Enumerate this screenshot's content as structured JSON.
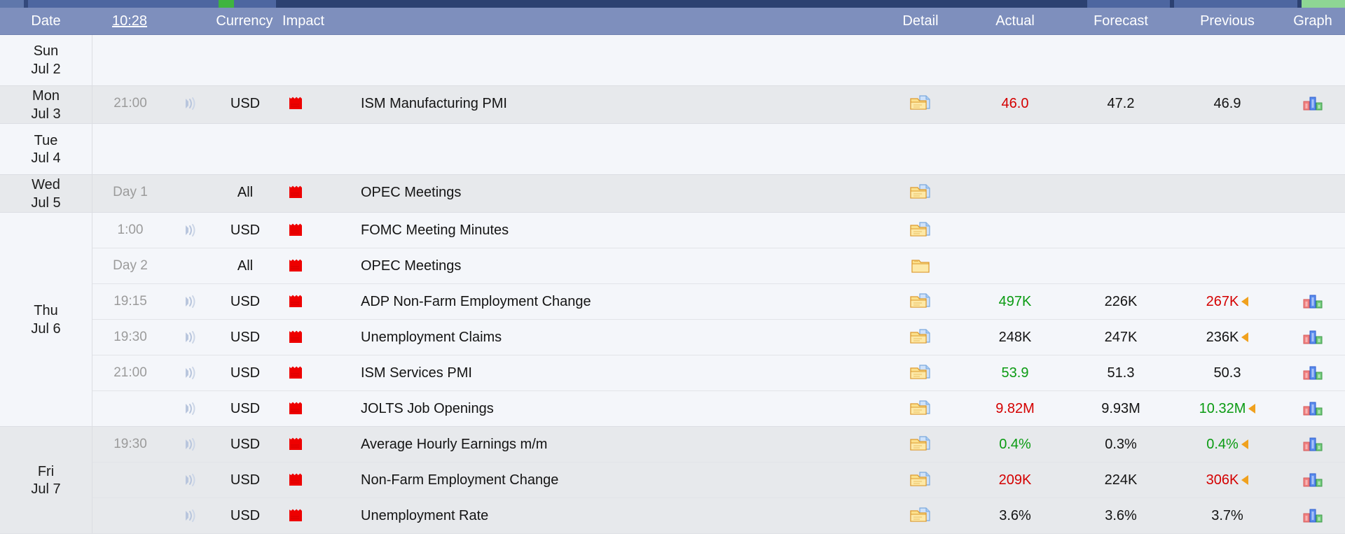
{
  "header": {
    "columns": {
      "date": "Date",
      "time": "10:28",
      "currency": "Currency",
      "impact": "Impact",
      "detail": "Detail",
      "actual": "Actual",
      "forecast": "Forecast",
      "previous": "Previous",
      "graph": "Graph"
    },
    "accent_bg": "#7e8fbd",
    "accent_text": "#ffffff",
    "topbar_bg": "#33497c",
    "topbar_highlight": "#3fb43f"
  },
  "icons": {
    "sound": "sound-icon",
    "impact": "red-folded-flag-icon",
    "detail": "folder-document-icon",
    "detail_plain": "folder-icon",
    "graph": "bar-chart-icon",
    "revision": "revision-triangle-icon"
  },
  "colors": {
    "value_worse": "#d40000",
    "value_better": "#0a9b12",
    "value_neutral": "#141414",
    "revision": "#f0a11e",
    "row_light": "#f4f6fa",
    "row_dark": "#e7e9ec"
  },
  "days": [
    {
      "weekday": "Sun",
      "date": "Jul 2",
      "band": "light",
      "events": []
    },
    {
      "weekday": "Mon",
      "date": "Jul 3",
      "band": "dark",
      "events": [
        {
          "time": "21:00",
          "sound": true,
          "currency": "USD",
          "impact": "high",
          "event": "ISM Manufacturing PMI",
          "detail": "folder-document",
          "actual": "46.0",
          "actual_tone": "red",
          "forecast": "47.2",
          "previous": "46.9",
          "previous_tone": "black",
          "previous_revised": false,
          "graph": true
        }
      ]
    },
    {
      "weekday": "Tue",
      "date": "Jul 4",
      "band": "light",
      "events": []
    },
    {
      "weekday": "Wed",
      "date": "Jul 5",
      "band": "dark",
      "events": [
        {
          "time": "Day 1",
          "sound": false,
          "currency": "All",
          "impact": "high",
          "event": "OPEC Meetings",
          "detail": "folder-document",
          "actual": "",
          "actual_tone": "black",
          "forecast": "",
          "previous": "",
          "previous_tone": "black",
          "previous_revised": false,
          "graph": false
        }
      ]
    },
    {
      "weekday": "Thu",
      "date": "Jul 6",
      "band": "light",
      "events": [
        {
          "time": "1:00",
          "sound": true,
          "currency": "USD",
          "impact": "high",
          "event": "FOMC Meeting Minutes",
          "detail": "folder-document",
          "actual": "",
          "actual_tone": "black",
          "forecast": "",
          "previous": "",
          "previous_tone": "black",
          "previous_revised": false,
          "graph": false
        },
        {
          "time": "Day 2",
          "sound": false,
          "currency": "All",
          "impact": "high",
          "event": "OPEC Meetings",
          "detail": "folder",
          "actual": "",
          "actual_tone": "black",
          "forecast": "",
          "previous": "",
          "previous_tone": "black",
          "previous_revised": false,
          "graph": false
        },
        {
          "time": "19:15",
          "sound": true,
          "currency": "USD",
          "impact": "high",
          "event": "ADP Non-Farm Employment Change",
          "detail": "folder-document",
          "actual": "497K",
          "actual_tone": "green",
          "forecast": "226K",
          "previous": "267K",
          "previous_tone": "red",
          "previous_revised": true,
          "graph": true
        },
        {
          "time": "19:30",
          "sound": true,
          "currency": "USD",
          "impact": "high",
          "event": "Unemployment Claims",
          "detail": "folder-document",
          "actual": "248K",
          "actual_tone": "black",
          "forecast": "247K",
          "previous": "236K",
          "previous_tone": "black",
          "previous_revised": true,
          "graph": true
        },
        {
          "time": "21:00",
          "sound": true,
          "currency": "USD",
          "impact": "high",
          "event": "ISM Services PMI",
          "detail": "folder-document",
          "actual": "53.9",
          "actual_tone": "green",
          "forecast": "51.3",
          "previous": "50.3",
          "previous_tone": "black",
          "previous_revised": false,
          "graph": true
        },
        {
          "time": "",
          "sound": true,
          "currency": "USD",
          "impact": "high",
          "event": "JOLTS Job Openings",
          "detail": "folder-document",
          "actual": "9.82M",
          "actual_tone": "red",
          "forecast": "9.93M",
          "previous": "10.32M",
          "previous_tone": "green",
          "previous_revised": true,
          "graph": true
        }
      ]
    },
    {
      "weekday": "Fri",
      "date": "Jul 7",
      "band": "dark",
      "events": [
        {
          "time": "19:30",
          "sound": true,
          "currency": "USD",
          "impact": "high",
          "event": "Average Hourly Earnings m/m",
          "detail": "folder-document",
          "actual": "0.4%",
          "actual_tone": "green",
          "forecast": "0.3%",
          "previous": "0.4%",
          "previous_tone": "green",
          "previous_revised": true,
          "graph": true
        },
        {
          "time": "",
          "sound": true,
          "currency": "USD",
          "impact": "high",
          "event": "Non-Farm Employment Change",
          "detail": "folder-document",
          "actual": "209K",
          "actual_tone": "red",
          "forecast": "224K",
          "previous": "306K",
          "previous_tone": "red",
          "previous_revised": true,
          "graph": true
        },
        {
          "time": "",
          "sound": true,
          "currency": "USD",
          "impact": "high",
          "event": "Unemployment Rate",
          "detail": "folder-document",
          "actual": "3.6%",
          "actual_tone": "black",
          "forecast": "3.6%",
          "previous": "3.7%",
          "previous_tone": "black",
          "previous_revised": false,
          "graph": true
        }
      ]
    }
  ]
}
